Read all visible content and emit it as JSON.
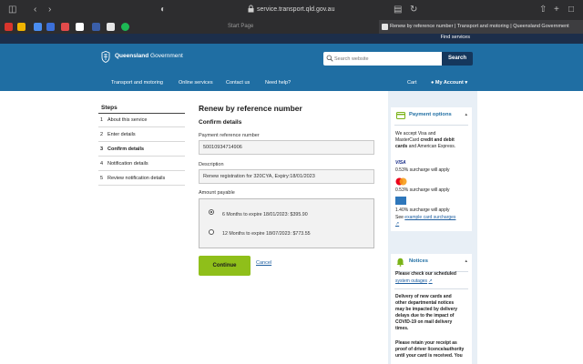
{
  "browser": {
    "url": "service.transport.qld.gov.au",
    "tab_start": "Start Page",
    "tab_active": "Renew by reference number | Transport and motoring | Queensland Government"
  },
  "site": {
    "find_services": "Find services",
    "logo_bold": "Queensland",
    "logo_rest": " Government",
    "search_placeholder": "Search website",
    "search_button": "Search",
    "nav": [
      "Transport and motoring",
      "Online services",
      "Contact us",
      "Need help?"
    ],
    "cart": "Cart",
    "account": "My Account"
  },
  "steps": {
    "title": "Steps",
    "items": [
      {
        "num": "1",
        "label": "About this service"
      },
      {
        "num": "2",
        "label": "Enter details"
      },
      {
        "num": "3",
        "label": "Confirm details"
      },
      {
        "num": "4",
        "label": "Notification details"
      },
      {
        "num": "5",
        "label": "Review notification details"
      }
    ]
  },
  "main": {
    "title": "Renew by reference number",
    "section": "Confirm details",
    "ref_label": "Payment reference number",
    "ref_value": "50010934714906",
    "desc_label": "Description",
    "desc_value": "Renew registration for 320CYA, Expiry:18/01/2023",
    "amount_label": "Amount payable",
    "options": [
      "6 Months to expire 18/01/2023: $395.90",
      "12 Months to expire 18/07/2023: $773.55"
    ],
    "continue": "Continue",
    "cancel": "Cancel"
  },
  "payment": {
    "title": "Payment options",
    "intro_1": "We accept Visa and",
    "intro_2": "MasterCard ",
    "intro_2b": "credit and debit",
    "intro_3": "cards",
    "intro_3b": " and American Express.",
    "visa_label": "VISA",
    "visa_fee": "0.53% surcharge will apply",
    "mc_fee": "0.53% surcharge will apply",
    "amex_fee": "1.40% surcharge will apply",
    "see_1": "See ",
    "see_link": "example card surcharges"
  },
  "notices": {
    "title": "Notices",
    "line_1": "Please check our scheduled",
    "link": "system outages",
    "delivery": [
      "Delivery of new cards and",
      "other departmental notices",
      "may be impacted by delivery",
      "delays due to the impact of",
      "COVID-19 on mail delivery",
      "times."
    ],
    "retain": [
      "Please retain your receipt as",
      "proof of driver licence/authority",
      "until your card is received. You"
    ]
  },
  "colors": {
    "header_blue": "#1f6ea3",
    "continue_green": "#8fbf1a",
    "sidebar_bg": "#e8eff6"
  }
}
